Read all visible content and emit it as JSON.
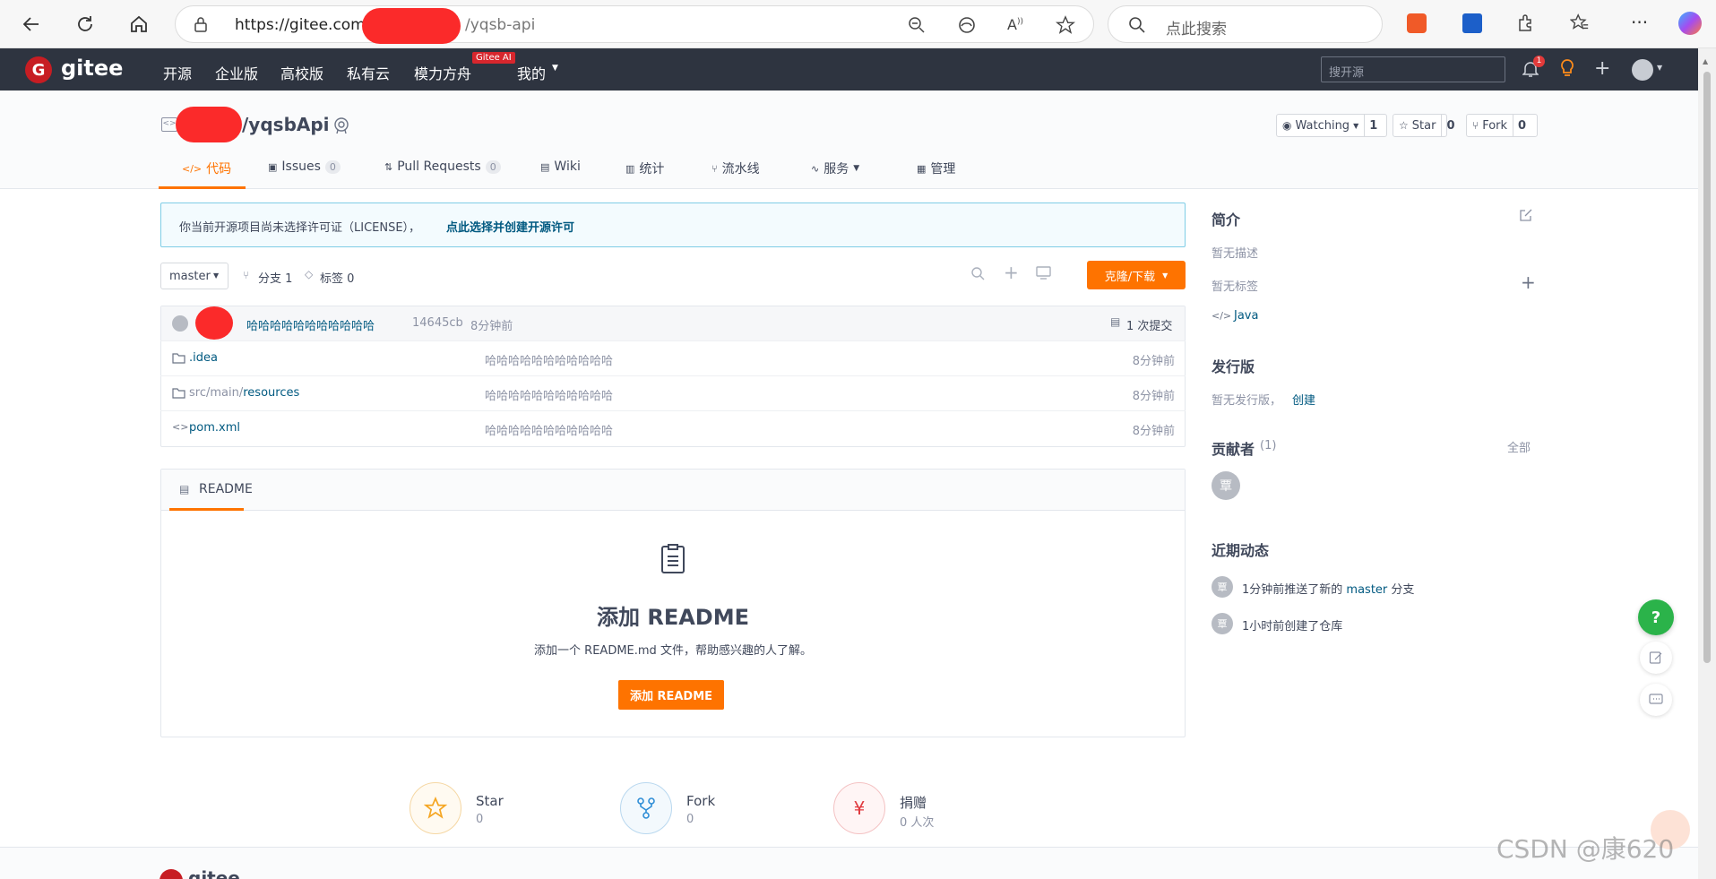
{
  "browser": {
    "url_prefix": "https://gitee.com",
    "url_suffix": "/yqsb-api",
    "search_placeholder": "点此搜索"
  },
  "nav": {
    "logo_text": "gitee",
    "items": [
      "开源",
      "企业版",
      "高校版",
      "私有云",
      "模力方舟",
      "我的"
    ],
    "ai_badge": "Gitee AI",
    "search_placeholder": "搜开源",
    "notif_count": "1"
  },
  "repo": {
    "name": "/yqsbApi",
    "watch_label": "Watching",
    "watch_count": "1",
    "star_label": "Star",
    "star_count": "0",
    "fork_label": "Fork",
    "fork_count": "0",
    "tabs": [
      {
        "label": "代码"
      },
      {
        "label": "Issues",
        "count": "0"
      },
      {
        "label": "Pull Requests",
        "count": "0"
      },
      {
        "label": "Wiki"
      },
      {
        "label": "统计"
      },
      {
        "label": "流水线"
      },
      {
        "label": "服务"
      },
      {
        "label": "管理"
      }
    ]
  },
  "license": {
    "text": "你当前开源项目尚未选择许可证（LICENSE），",
    "link": "点此选择并创建开源许可"
  },
  "toolbar": {
    "branch": "master",
    "branches": "分支 1",
    "tags": "标签 0",
    "clone": "克隆/下载"
  },
  "commit": {
    "message": "哈哈哈哈哈哈哈哈哈哈哈",
    "hash": "14645cb",
    "time": "8分钟前",
    "count": "1 次提交"
  },
  "files": [
    {
      "name": ".idea",
      "path_prefix": "",
      "type": "folder",
      "message": "哈哈哈哈哈哈哈哈哈哈哈",
      "time": "8分钟前"
    },
    {
      "name": "resources",
      "path_prefix": "src/main/",
      "type": "folder",
      "message": "哈哈哈哈哈哈哈哈哈哈哈",
      "time": "8分钟前"
    },
    {
      "name": "pom.xml",
      "path_prefix": "",
      "type": "file",
      "message": "哈哈哈哈哈哈哈哈哈哈哈",
      "time": "8分钟前"
    }
  ],
  "readme": {
    "tab": "README",
    "title": "添加 README",
    "desc": "添加一个 README.md 文件，帮助感兴趣的人了解。",
    "button": "添加 README"
  },
  "sidebar": {
    "intro_title": "简介",
    "no_desc": "暂无描述",
    "no_tags": "暂无标签",
    "language": "Java",
    "release_title": "发行版",
    "no_release": "暂无发行版，",
    "create": "创建",
    "contrib_title": "贡献者",
    "contrib_count": "(1)",
    "all": "全部",
    "avatar_char": "覃",
    "activity_title": "近期动态",
    "activity1_pre": "1分钟前推送了新的",
    "activity1_branch": "master",
    "activity1_post": "分支",
    "activity2": "1小时前创建了仓库"
  },
  "stats": [
    {
      "label": "Star",
      "value": "0",
      "color": "#f5a623"
    },
    {
      "label": "Fork",
      "value": "0",
      "color": "#2f8ed6"
    },
    {
      "label": "捐赠",
      "value": "0 人次",
      "color": "#e0393e"
    }
  ],
  "watermark": "CSDN @康620",
  "footer_logo": "gitee",
  "help_icon": "?"
}
